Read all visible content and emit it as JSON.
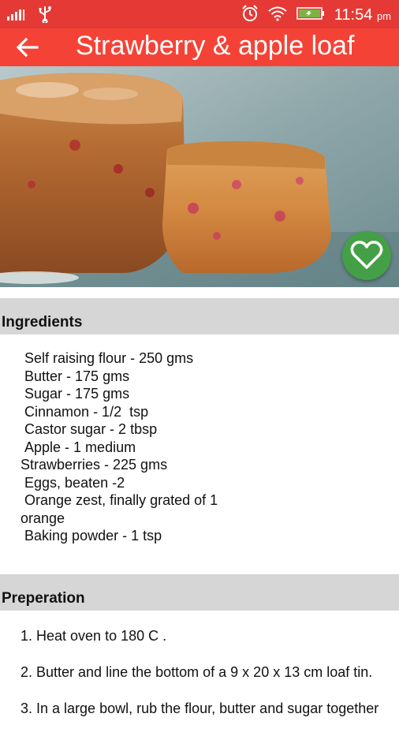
{
  "status_bar": {
    "time": "11:54",
    "ampm": "pm",
    "icons": [
      "signal-icon",
      "usb-icon",
      "alarm-icon",
      "wifi-icon",
      "battery-icon"
    ]
  },
  "app_bar": {
    "title": "Strawberry & apple loaf",
    "back_icon": "arrow-left-icon"
  },
  "favorite": {
    "icon": "heart-icon",
    "color": "#43a047"
  },
  "colors": {
    "status_bar": "#e53935",
    "app_bar": "#f44336",
    "section_header": "#d6d6d6"
  },
  "ingredients": {
    "heading": "Ingredients",
    "items": [
      " Self raising flour - 250 gms",
      " Butter - 175 gms",
      " Sugar - 175 gms",
      " Cinnamon - 1/2  tsp",
      " Castor sugar - 2 tbsp",
      " Apple - 1 medium",
      "Strawberries - 225 gms",
      " Eggs, beaten -2",
      " Orange zest, finally grated of 1\norange",
      " Baking powder - 1 tsp"
    ]
  },
  "preparation": {
    "heading": "Preperation",
    "steps": [
      "1. Heat oven to 180 C .",
      "2. Butter and line the bottom of a 9 x 20 x 13 cm loaf tin.",
      "3. In a large bowl, rub the flour, butter and sugar together"
    ]
  }
}
